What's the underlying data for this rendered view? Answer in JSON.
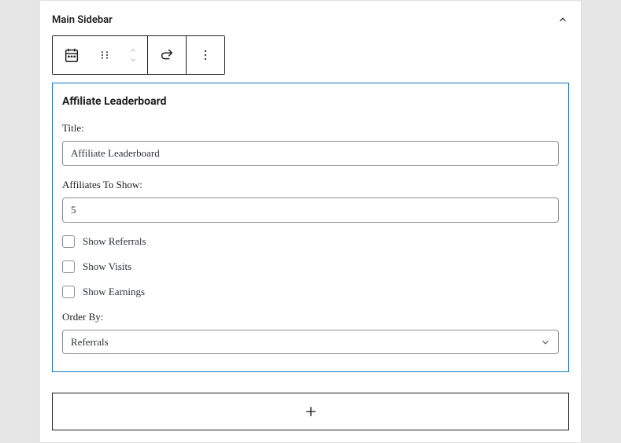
{
  "panel": {
    "title": "Main Sidebar"
  },
  "widget": {
    "title": "Affiliate Leaderboard",
    "fields": {
      "title_label": "Title:",
      "title_value": "Affiliate Leaderboard",
      "count_label": "Affiliates To Show:",
      "count_value": "5",
      "show_referrals_label": "Show Referrals",
      "show_visits_label": "Show Visits",
      "show_earnings_label": "Show Earnings",
      "orderby_label": "Order By:",
      "orderby_value": "Referrals"
    }
  }
}
